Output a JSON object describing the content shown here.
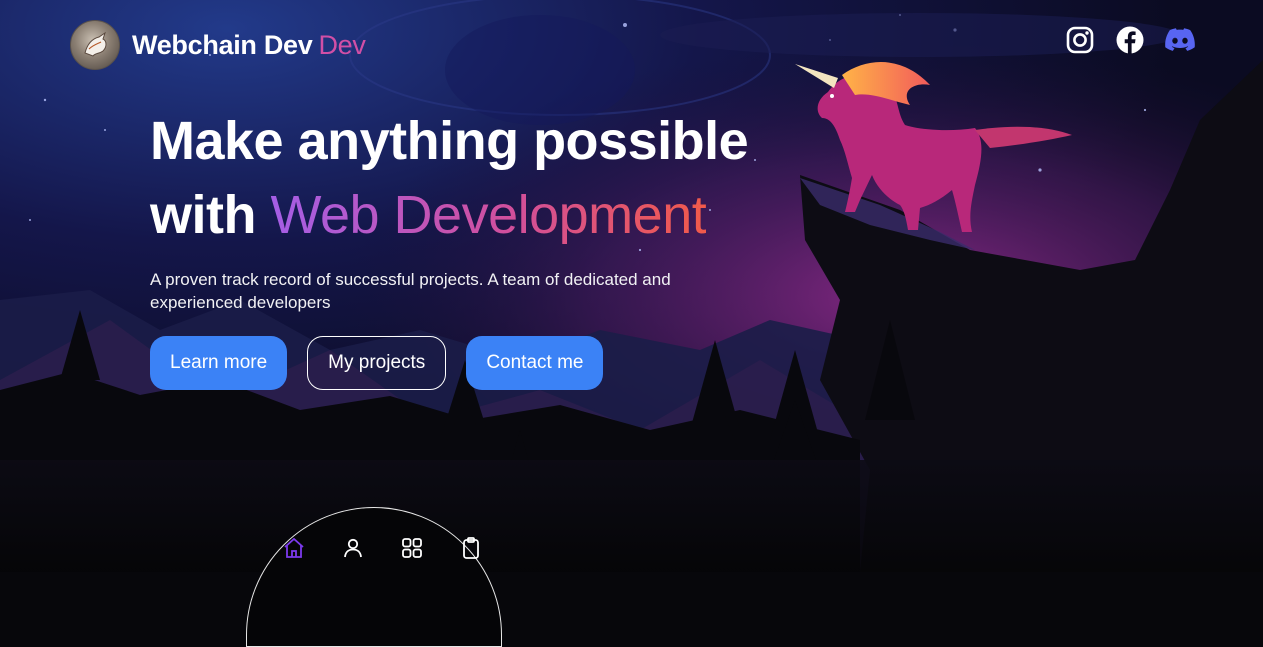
{
  "brand": {
    "name": "Webchain Dev",
    "accent": "Dev",
    "logo": "horse-logo-icon"
  },
  "socials": [
    {
      "icon": "instagram-icon"
    },
    {
      "icon": "facebook-icon"
    },
    {
      "icon": "discord-icon",
      "color": "#5865f2"
    }
  ],
  "hero": {
    "title_line1": "Make anything possible",
    "title_with": "with",
    "title_highlight": "Web Development",
    "subtitle": "A proven track record of successful projects. A team of dedicated and experienced developers",
    "buttons": {
      "learn_more": "Learn more",
      "my_projects": "My projects",
      "contact_me": "Contact me"
    }
  },
  "dock": {
    "items": [
      "home-icon",
      "user-icon",
      "grid-icon",
      "clipboard-icon"
    ],
    "active": "home-icon"
  },
  "colors": {
    "primary_button": "#3b82f6",
    "brand_accent": "#d14fa6",
    "active_nav": "#7c3aed",
    "gradient": [
      "#a55ee6",
      "#d14f9c",
      "#f15a4a"
    ]
  }
}
